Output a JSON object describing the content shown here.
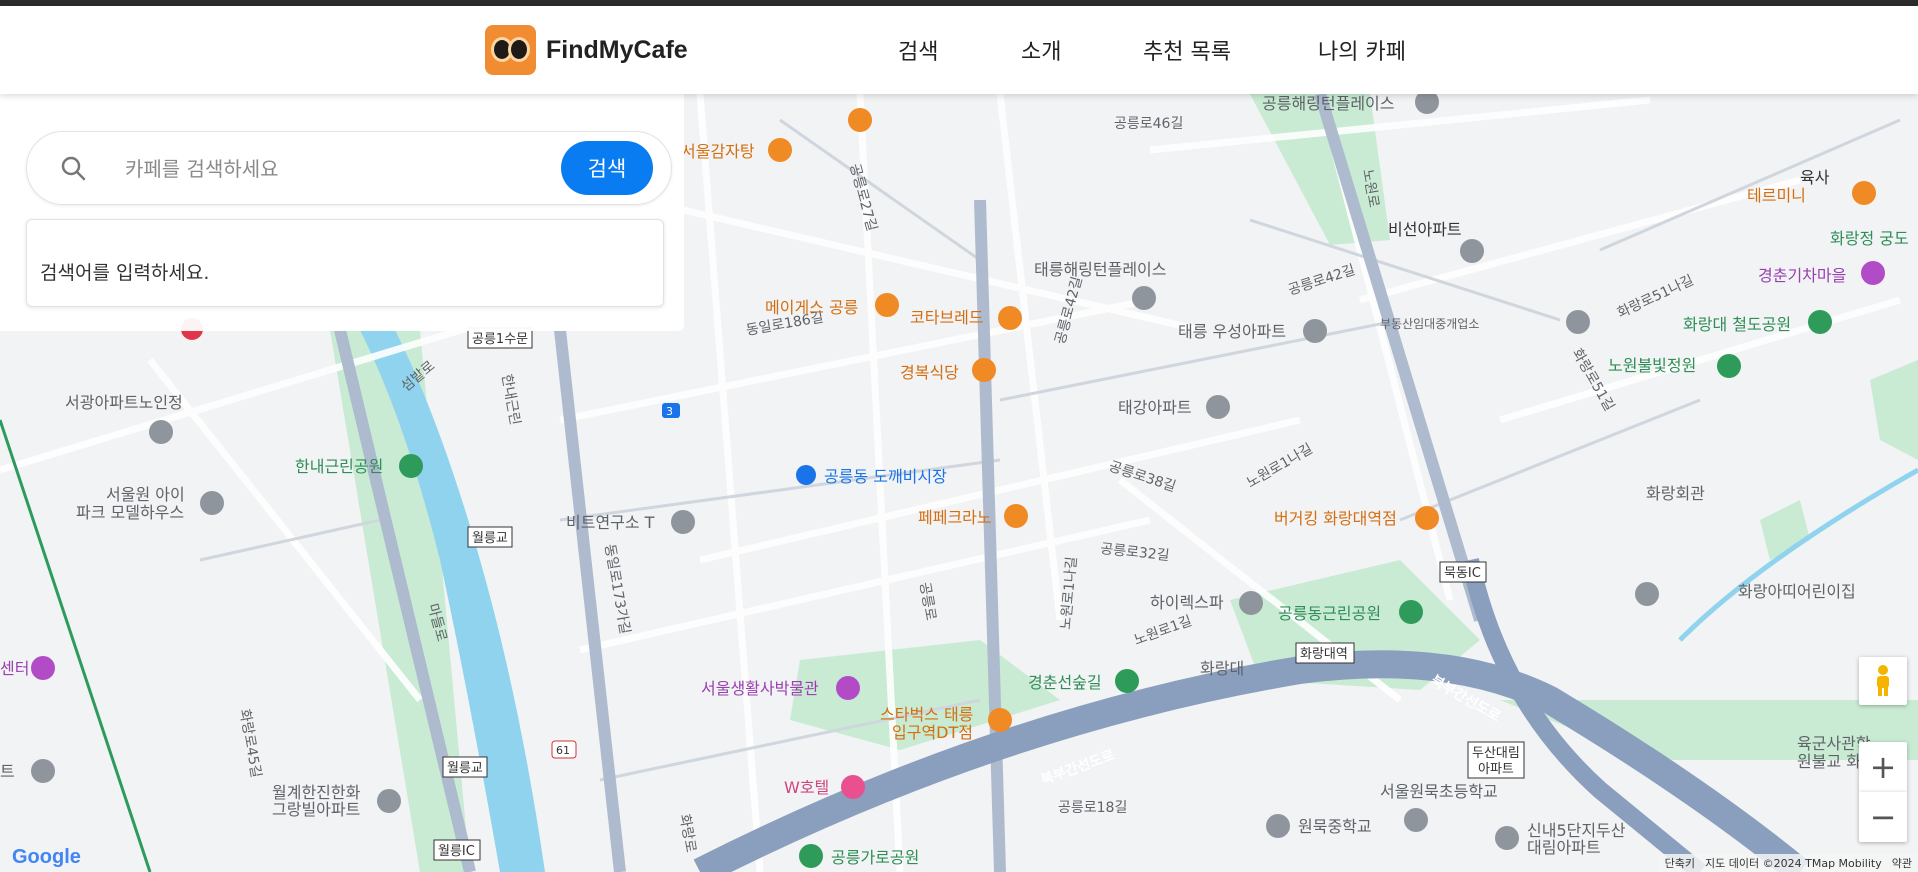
{
  "brand": {
    "name": "FindMyCafe"
  },
  "nav": {
    "items": [
      "검색",
      "소개",
      "추천 목록",
      "나의 카페"
    ]
  },
  "search": {
    "placeholder": "카페를 검색하세요",
    "button": "검색",
    "empty_message": "검색어를 입력하세요."
  },
  "map": {
    "labels": {
      "l1": "공릉해링턴플레이스",
      "l2": "공릉로46길",
      "l3": "공릉로27길",
      "l4": "서울감자탕",
      "l5": "노원로",
      "l6": "테르미니",
      "l7": "육사",
      "l8": "화랑정 궁도",
      "l9": "비선아파트",
      "l10": "태릉해링턴플레이스",
      "l11": "공릉로42길",
      "l12": "화랑로51나길",
      "l13": "경춘기차마을",
      "l14": "메이게스 공릉",
      "l15": "코타브레드",
      "l16": "동일로186길",
      "l17": "부동산임대중개업소",
      "l18": "태릉 우성아파트",
      "l19": "화랑대 철도공원",
      "l20": "경복식당",
      "l21": "공릉로42길",
      "l22": "노원불빛정원",
      "l23": "공릉1수문",
      "l24": "섬밭로",
      "l25": "서광아파트노인정",
      "l26": "태강아파트",
      "l27": "화랑로51길",
      "l28": "한내근린공원",
      "l29": "공릉동 도깨비시장",
      "l30": "공릉로38길",
      "l31": "노원로1나길",
      "l32": "화랑회관",
      "l33": "서울원 아이",
      "l34": "파크 모델하우스",
      "l35": "비트연구소 T",
      "l36": "월릉교",
      "l37": "페페크라노",
      "l38": "버거킹 화랑대역점",
      "l39": "공릉로32길",
      "l40": "동일로173가길",
      "l41": "묵동IC",
      "l42": "화랑아띠어린이집",
      "l43": "하이렉스파",
      "l44": "공릉동근린공원",
      "l45": "마들로",
      "l46": "공릉로",
      "l47": "노원로1나길",
      "l48": "노원로1길",
      "l49": "화랑대역",
      "l50": "센터",
      "l51": "서울생활사박물관",
      "l52": "화랑대",
      "l53": "경춘선숲길",
      "l54": "북부간선도로",
      "l55": "스타벅스 태릉",
      "l56": "입구역DT점",
      "l57": "화랑로45길",
      "l58": "두산대림",
      "l59": "아파트",
      "l60": "육군사관학",
      "l61": "원불교 화랑",
      "l62": "트",
      "l63": "월릉교",
      "l64": "W호텔",
      "l65": "북부간선도로",
      "l66": "월계한진한화",
      "l67": "그랑빌아파트",
      "l68": "공릉로18길",
      "l69": "서울원묵초등학교",
      "l70": "원묵중학교",
      "l71": "신내5단지두산",
      "l72": "대림아파트",
      "l73": "공릉가로공원",
      "l74": "월릉IC",
      "l75": "화랑로",
      "l76": "북부간선도로",
      "l77": "한내근린",
      "l78": "3",
      "l79": "61"
    }
  },
  "map_footer": {
    "google": "Google",
    "shortcuts": "단축키",
    "data": "지도 데이터 ©2024 TMap Mobility",
    "terms": "약관"
  },
  "colors": {
    "accent": "#0a7cf1",
    "brand_orange": "#f28c33",
    "park": "#c9ebd3",
    "river": "#8fd3ee",
    "highway": "#8a9fbd"
  }
}
